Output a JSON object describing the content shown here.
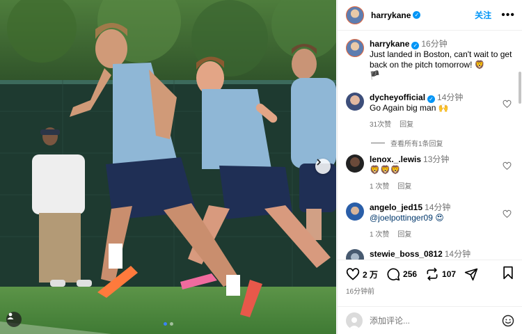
{
  "post": {
    "author": "harrykane",
    "follow_label": "关注",
    "more_label": "•••",
    "caption_author": "harrykane",
    "caption_time": "16分钟",
    "caption_text": "Just landed in Boston, can't wait to get back on the pitch tomorrow! 🦁",
    "caption_flag": "🏴"
  },
  "comments": [
    {
      "user": "dycheyofficial",
      "verified": true,
      "time": "14分钟",
      "text": "Go Again big man 🙌",
      "likes": "31次赞",
      "reply": "回复",
      "view_replies": "查看所有1条回复"
    },
    {
      "user": "lenox._.lewis",
      "verified": false,
      "time": "13分钟",
      "text": "🦁🦁🦁",
      "likes": "1 次赞",
      "reply": "回复"
    },
    {
      "user": "angelo_jed15",
      "verified": false,
      "time": "14分钟",
      "text": "@joelpottinger09 😍",
      "likes": "1 次赞",
      "reply": "回复"
    },
    {
      "user": "stewie_boss_0812",
      "verified": false,
      "time": "14分钟"
    }
  ],
  "actions": {
    "likes": "2 万",
    "comments": "256",
    "shares": "107",
    "posted": "16分钟前"
  },
  "composer": {
    "placeholder": "添加评论..."
  },
  "carousel": {
    "total": 2,
    "current": 1
  },
  "colors": {
    "accent": "#0095f6",
    "muted": "#737373",
    "carousel_active": "#3b82f6"
  },
  "icons": [
    "heart-icon",
    "comment-icon",
    "share-icon",
    "send-icon",
    "bookmark-icon",
    "emoji-icon",
    "verified-icon",
    "chevron-right-icon",
    "user-icon",
    "more-icon"
  ]
}
